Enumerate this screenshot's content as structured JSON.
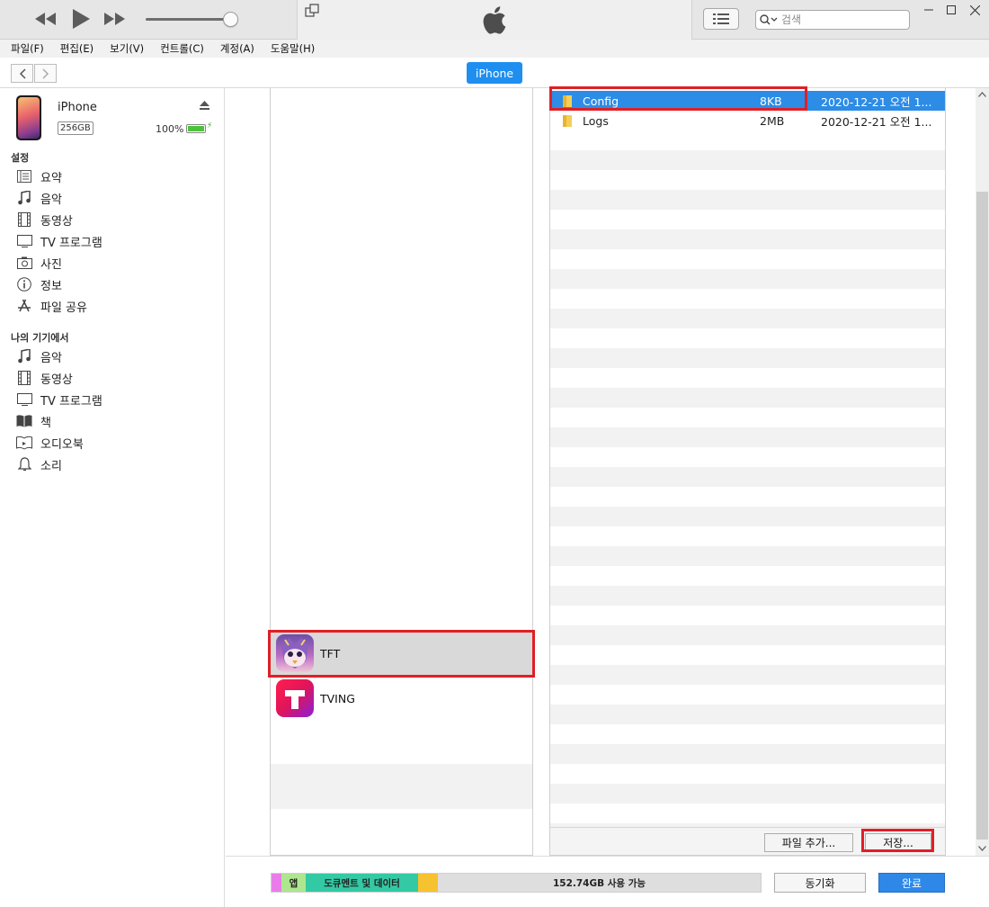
{
  "search": {
    "placeholder": "검색"
  },
  "menu": [
    "파일(F)",
    "편집(E)",
    "보기(V)",
    "컨트롤(C)",
    "계정(A)",
    "도움말(H)"
  ],
  "device_tab": "iPhone",
  "device": {
    "name": "iPhone",
    "capacity": "256GB",
    "battery": "100%"
  },
  "sidebar": {
    "settings_header": "설정",
    "settings": [
      {
        "label": "요약",
        "icon": "summary-icon"
      },
      {
        "label": "음악",
        "icon": "music-icon"
      },
      {
        "label": "동영상",
        "icon": "film-icon"
      },
      {
        "label": "TV 프로그램",
        "icon": "tv-icon"
      },
      {
        "label": "사진",
        "icon": "camera-icon"
      },
      {
        "label": "정보",
        "icon": "info-icon"
      },
      {
        "label": "파일 공유",
        "icon": "app-store-icon"
      }
    ],
    "ondevice_header": "나의 기기에서",
    "ondevice": [
      {
        "label": "음악",
        "icon": "music-icon"
      },
      {
        "label": "동영상",
        "icon": "film-icon"
      },
      {
        "label": "TV 프로그램",
        "icon": "tv-icon"
      },
      {
        "label": "책",
        "icon": "book-icon"
      },
      {
        "label": "오디오북",
        "icon": "audiobook-icon"
      },
      {
        "label": "소리",
        "icon": "bell-icon"
      }
    ]
  },
  "apps": [
    {
      "name": "TFT",
      "icon": "tft-app-icon",
      "selected": true
    },
    {
      "name": "TVING",
      "icon": "tving-app-icon",
      "selected": false
    }
  ],
  "files": [
    {
      "name": "Config",
      "size": "8KB",
      "date": "2020-12-21 오전 1...",
      "selected": true
    },
    {
      "name": "Logs",
      "size": "2MB",
      "date": "2020-12-21 오전 1...",
      "selected": false
    }
  ],
  "buttons": {
    "add_file": "파일 추가...",
    "save": "저장...",
    "sync": "동기화",
    "done": "완료"
  },
  "capacity": {
    "segments": [
      {
        "label": "",
        "color": "#e97ce8"
      },
      {
        "label": "앱",
        "color": "#aee68f"
      },
      {
        "label": "도큐멘트 및 데이터",
        "color": "#33c9a4"
      },
      {
        "label": "",
        "color": "#f6c230"
      }
    ],
    "free_label": "152.74GB 사용 가능"
  },
  "colors": {
    "accent": "#1e8ff0",
    "selection": "#2c8ce6",
    "highlight_box": "#e01f26"
  }
}
